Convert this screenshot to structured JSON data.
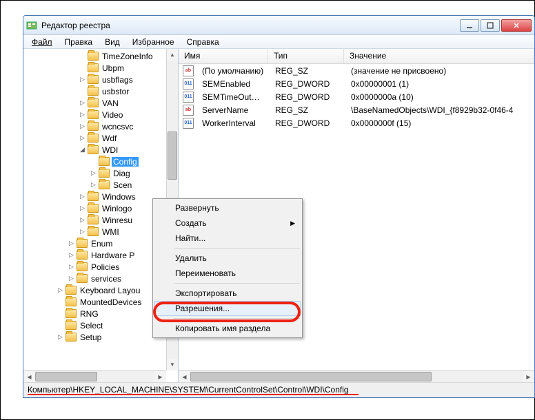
{
  "window": {
    "title": "Редактор реестра"
  },
  "menus": [
    "Файл",
    "Правка",
    "Вид",
    "Избранное",
    "Справка"
  ],
  "tree": [
    {
      "ind": "indent-1",
      "exp": "",
      "label": "TimeZoneInfo"
    },
    {
      "ind": "indent-1",
      "exp": "",
      "label": "Ubpm"
    },
    {
      "ind": "indent-1",
      "exp": "▷",
      "label": "usbflags"
    },
    {
      "ind": "indent-1",
      "exp": "",
      "label": "usbstor"
    },
    {
      "ind": "indent-1",
      "exp": "▷",
      "label": "VAN"
    },
    {
      "ind": "indent-1",
      "exp": "▷",
      "label": "Video"
    },
    {
      "ind": "indent-1",
      "exp": "▷",
      "label": "wcncsvc"
    },
    {
      "ind": "indent-1",
      "exp": "▷",
      "label": "Wdf"
    },
    {
      "ind": "indent-1",
      "exp": "◢",
      "label": "WDI"
    },
    {
      "ind": "indent-2",
      "exp": "",
      "label": "Config",
      "selected": true
    },
    {
      "ind": "indent-2",
      "exp": "▷",
      "label": "Diag"
    },
    {
      "ind": "indent-2",
      "exp": "▷",
      "label": "Scen"
    },
    {
      "ind": "indent-1",
      "exp": "▷",
      "label": "Windows"
    },
    {
      "ind": "indent-1",
      "exp": "▷",
      "label": "Winlogo"
    },
    {
      "ind": "indent-1",
      "exp": "▷",
      "label": "Winresu"
    },
    {
      "ind": "indent-1",
      "exp": "▷",
      "label": "WMI"
    },
    {
      "ind": "indent-e",
      "exp": "▷",
      "label": "Enum"
    },
    {
      "ind": "indent-e",
      "exp": "▷",
      "label": "Hardware P"
    },
    {
      "ind": "indent-e",
      "exp": "▷",
      "label": "Policies"
    },
    {
      "ind": "indent-e",
      "exp": "▷",
      "label": "services"
    },
    {
      "ind": "indent-k",
      "exp": "▷",
      "label": "Keyboard Layou"
    },
    {
      "ind": "indent-k",
      "exp": "",
      "label": "MountedDevices"
    },
    {
      "ind": "indent-k",
      "exp": "",
      "label": "RNG"
    },
    {
      "ind": "indent-k",
      "exp": "",
      "label": "Select"
    },
    {
      "ind": "indent-k",
      "exp": "▷",
      "label": "Setup"
    }
  ],
  "columns": {
    "name": "Имя",
    "type": "Тип",
    "value": "Значение"
  },
  "values": [
    {
      "icon": "sz",
      "iconTxt": "ab",
      "name": "(По умолчанию)",
      "type": "REG_SZ",
      "val": "(значение не присвоено)"
    },
    {
      "icon": "dw",
      "iconTxt": "011",
      "name": "SEMEnabled",
      "type": "REG_DWORD",
      "val": "0x00000001 (1)"
    },
    {
      "icon": "dw",
      "iconTxt": "011",
      "name": "SEMTimeOutVal...",
      "type": "REG_DWORD",
      "val": "0x0000000a (10)"
    },
    {
      "icon": "sz",
      "iconTxt": "ab",
      "name": "ServerName",
      "type": "REG_SZ",
      "val": "\\BaseNamedObjects\\WDI_{f8929b32-0f46-4"
    },
    {
      "icon": "dw",
      "iconTxt": "011",
      "name": "WorkerInterval",
      "type": "REG_DWORD",
      "val": "0x0000000f (15)"
    }
  ],
  "ctx": {
    "expand": "Развернуть",
    "create": "Создать",
    "find": "Найти...",
    "delete": "Удалить",
    "rename": "Переименовать",
    "export": "Экспортировать",
    "perms": "Разрешения...",
    "copy": "Копировать имя раздела"
  },
  "status": "Компьютер\\HKEY_LOCAL_MACHINE\\SYSTEM\\CurrentControlSet\\Control\\WDI\\Config"
}
